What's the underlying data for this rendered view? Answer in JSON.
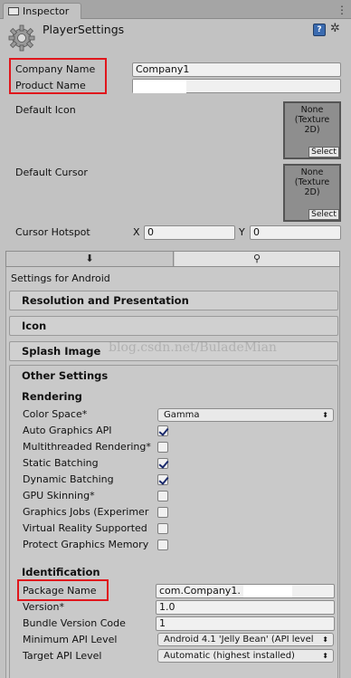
{
  "tab": {
    "label": "Inspector",
    "menu_icon": "menu-dots-icon"
  },
  "header": {
    "title": "PlayerSettings",
    "icon": "gear-icon",
    "help_icon": "help-book-icon",
    "help_glyph": "?",
    "settings_icon": "settings-gear-icon",
    "settings_glyph": "✲"
  },
  "company": {
    "label": "Company Name",
    "value": "Company1"
  },
  "product": {
    "label": "Product Name",
    "value": ""
  },
  "default_icon": {
    "label": "Default Icon",
    "slot_text": "None\n(Texture\n2D)",
    "select_label": "Select"
  },
  "default_cursor": {
    "label": "Default Cursor",
    "slot_text": "None\n(Texture\n2D)",
    "select_label": "Select"
  },
  "cursor_hotspot": {
    "label": "Cursor Hotspot",
    "x_label": "X",
    "x_value": "0",
    "y_label": "Y",
    "y_value": "0"
  },
  "platform_tabs": {
    "standalone_glyph": "⬇",
    "android_glyph": "⚲"
  },
  "settings_for": "Settings for Android",
  "sections": {
    "resolution": "Resolution and Presentation",
    "icon": "Icon",
    "splash": "Splash Image",
    "other": "Other Settings"
  },
  "watermark": "blog.csdn.net/BuladeMian",
  "rendering": {
    "heading": "Rendering",
    "color_space": {
      "label": "Color Space*",
      "value": "Gamma",
      "arrow": "⬍"
    },
    "toggles": [
      {
        "label": "Auto Graphics API",
        "checked": true
      },
      {
        "label": "Multithreaded Rendering*",
        "checked": false
      },
      {
        "label": "Static Batching",
        "checked": true
      },
      {
        "label": "Dynamic Batching",
        "checked": true
      },
      {
        "label": "GPU Skinning*",
        "checked": false
      },
      {
        "label": "Graphics Jobs (Experimer",
        "checked": false
      },
      {
        "label": "Virtual Reality Supported",
        "checked": false
      },
      {
        "label": "Protect Graphics Memory",
        "checked": false
      }
    ]
  },
  "identification": {
    "heading": "Identification",
    "package_name": {
      "label": "Package Name",
      "value": "com.Company1."
    },
    "version": {
      "label": "Version*",
      "value": "1.0"
    },
    "bundle_version_code": {
      "label": "Bundle Version Code",
      "value": "1"
    },
    "min_api": {
      "label": "Minimum API Level",
      "value": "Android 4.1 'Jelly Bean' (API level",
      "arrow": "⬍"
    },
    "target_api": {
      "label": "Target API Level",
      "value": "Automatic (highest installed)",
      "arrow": "⬍"
    }
  },
  "colors": {
    "highlight_box": "#e0161c",
    "panel_bg": "#c2c2c2"
  }
}
